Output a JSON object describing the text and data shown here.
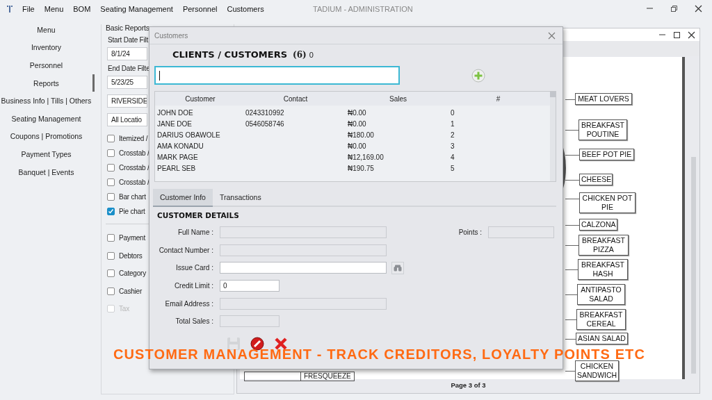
{
  "app": {
    "title": "TADIUM - ADMINISTRATION",
    "menu": [
      "File",
      "Menu",
      "BOM",
      "Seating Management",
      "Personnel",
      "Customers"
    ]
  },
  "nav": [
    {
      "label": "Menu",
      "selected": false
    },
    {
      "label": "Inventory",
      "selected": false
    },
    {
      "label": "Personnel",
      "selected": false
    },
    {
      "label": "Reports",
      "selected": true
    },
    {
      "label": "Business Info | Tills | Others",
      "selected": false
    },
    {
      "label": "Seating Management",
      "selected": false
    },
    {
      "label": "Coupons | Promotions",
      "selected": false
    },
    {
      "label": "Payment Types",
      "selected": false
    },
    {
      "label": "Banquet | Events",
      "selected": false
    }
  ],
  "filters": {
    "title": "Basic Reports",
    "start_label": "Start Date Filt",
    "start_value": "8/1/24",
    "end_label": "End Date Filte",
    "end_value": "5/23/25",
    "branch": "RIVERSIDE",
    "location": "All Locatio",
    "chart_options": [
      {
        "label": "Itemized /",
        "checked": false,
        "disabled": false
      },
      {
        "label": "Crosstab /",
        "checked": false,
        "disabled": false
      },
      {
        "label": "Crosstab /",
        "checked": false,
        "disabled": false
      },
      {
        "label": "Crosstab /",
        "checked": false,
        "disabled": false
      },
      {
        "label": "Bar chart",
        "checked": false,
        "disabled": false
      },
      {
        "label": "Pie chart",
        "checked": true,
        "disabled": false
      }
    ],
    "report_options": [
      {
        "label": "Payment",
        "checked": false,
        "disabled": false
      },
      {
        "label": "Debtors",
        "checked": false,
        "disabled": false
      },
      {
        "label": "Category",
        "checked": false,
        "disabled": false
      },
      {
        "label": "Cashier",
        "checked": false,
        "disabled": false
      },
      {
        "label": "Tax",
        "checked": false,
        "disabled": true
      }
    ]
  },
  "report": {
    "labels": [
      "MEAT LOVERS",
      "BREAKFAST POUTINE",
      "BEEF POT PIE",
      "CHEESE",
      "CHICKEN POT PIE",
      "CALZONA",
      "BREAKFAST PIZZA",
      "BREAKFAST HASH",
      "ANTIPASTO SALAD",
      "BREAKFAST CEREAL",
      "ASIAN SALAD",
      "CHICKEN SANDWICH"
    ],
    "cell": "FRESQUEEZE",
    "footer": "Page 3 of 3"
  },
  "dialog": {
    "title": "Customers",
    "heading": "CLIENTS / CUSTOMERS",
    "count": "(6)",
    "selection": "0",
    "search": {
      "focused": true
    },
    "table": {
      "columns": [
        "Customer",
        "Contact",
        "Sales",
        "#"
      ],
      "rows": [
        [
          "JOHN  DOE",
          "0243310992",
          "₦0.00",
          "0"
        ],
        [
          "JANE  DOE",
          "0546058746",
          "₦0.00",
          "1"
        ],
        [
          "DARIUS  OBAWOLE",
          "",
          "₦180.00",
          "2"
        ],
        [
          "AMA  KONADU",
          "",
          "₦0.00",
          "3"
        ],
        [
          "MARK  PAGE",
          "",
          "₦12,169.00",
          "4"
        ],
        [
          "PEARL  SEB",
          "",
          "₦190.75",
          "5"
        ]
      ]
    },
    "tabs": [
      {
        "label": "Customer Info",
        "selected": true
      },
      {
        "label": "Transactions",
        "selected": false
      }
    ],
    "section": "CUSTOMER DETAILS",
    "fields": [
      {
        "label": "Full Name :",
        "kind": "wide",
        "disabled": true
      },
      {
        "label": "Contact Number  :",
        "kind": "wide",
        "disabled": true
      },
      {
        "label": "Issue Card  :",
        "kind": "lookup",
        "disabled": false
      },
      {
        "label": "Credit Limit :",
        "kind": "short",
        "disabled": false,
        "value": "0"
      },
      {
        "label": "Email Address :",
        "kind": "wide",
        "disabled": true
      },
      {
        "label": "Total Sales :",
        "kind": "short",
        "disabled": true
      }
    ],
    "points": {
      "label": "Points :",
      "disabled": true
    },
    "buttons": [
      {
        "kind": "save",
        "disabled": true
      },
      {
        "kind": "close",
        "disabled": false
      },
      {
        "kind": "delete",
        "disabled": false
      }
    ]
  },
  "caption": "CUSTOMER MANAGEMENT - TRACK CREDITORS, LOYALTY POINTS ETC"
}
